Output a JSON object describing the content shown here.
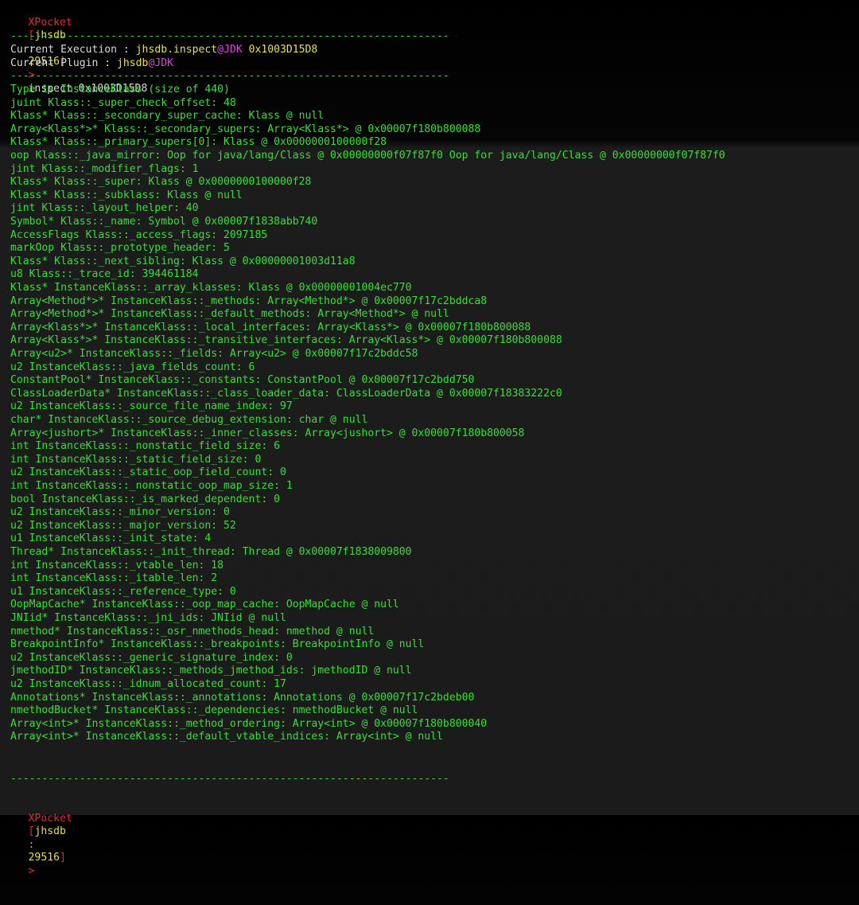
{
  "prompt": {
    "app": "XPocket",
    "open": "[",
    "plugin": "jhsdb",
    "sep": ":",
    "pid": "29516",
    "close": "]",
    "arrow": ">"
  },
  "command": "inspect 0x1003D15D8",
  "separator": "----------------------------------------------------------------------",
  "execution": {
    "label": "Current Execution : ",
    "plugin": "jhsdb",
    "dot": ".",
    "cmd": "inspect",
    "at": "@",
    "jdk": "JDK",
    "addr": " 0x1003D15D8"
  },
  "plugin_line": {
    "label": "Current Plugin : ",
    "plugin": "jhsdb",
    "at": "@",
    "jdk": "JDK"
  },
  "fields": [
    "Type is InstanceKlass (size of 440)",
    "juint Klass::_super_check_offset: 48",
    "Klass* Klass::_secondary_super_cache: Klass @ null",
    "Array<Klass*>* Klass::_secondary_supers: Array<Klass*> @ 0x00007f180b800088",
    "Klass* Klass::_primary_supers[0]: Klass @ 0x0000000100000f28",
    "oop Klass::_java_mirror: Oop for java/lang/Class @ 0x00000000f07f87f0 Oop for java/lang/Class @ 0x00000000f07f87f0",
    "jint Klass::_modifier_flags: 1",
    "Klass* Klass::_super: Klass @ 0x0000000100000f28",
    "Klass* Klass::_subklass: Klass @ null",
    "jint Klass::_layout_helper: 40",
    "Symbol* Klass::_name: Symbol @ 0x00007f1838abb740",
    "AccessFlags Klass::_access_flags: 2097185",
    "markOop Klass::_prototype_header: 5",
    "Klass* Klass::_next_sibling: Klass @ 0x00000001003d11a8",
    "u8 Klass::_trace_id: 394461184",
    "Klass* InstanceKlass::_array_klasses: Klass @ 0x00000001004ec770",
    "Array<Method*>* InstanceKlass::_methods: Array<Method*> @ 0x00007f17c2bddca8",
    "Array<Method*>* InstanceKlass::_default_methods: Array<Method*> @ null",
    "Array<Klass*>* InstanceKlass::_local_interfaces: Array<Klass*> @ 0x00007f180b800088",
    "Array<Klass*>* InstanceKlass::_transitive_interfaces: Array<Klass*> @ 0x00007f180b800088",
    "Array<u2>* InstanceKlass::_fields: Array<u2> @ 0x00007f17c2bddc58",
    "u2 InstanceKlass::_java_fields_count: 6",
    "ConstantPool* InstanceKlass::_constants: ConstantPool @ 0x00007f17c2bdd750",
    "ClassLoaderData* InstanceKlass::_class_loader_data: ClassLoaderData @ 0x00007f18383222c0",
    "u2 InstanceKlass::_source_file_name_index: 97",
    "char* InstanceKlass::_source_debug_extension: char @ null",
    "Array<jushort>* InstanceKlass::_inner_classes: Array<jushort> @ 0x00007f180b800058",
    "int InstanceKlass::_nonstatic_field_size: 6",
    "int InstanceKlass::_static_field_size: 0",
    "u2 InstanceKlass::_static_oop_field_count: 0",
    "int InstanceKlass::_nonstatic_oop_map_size: 1",
    "bool InstanceKlass::_is_marked_dependent: 0",
    "u2 InstanceKlass::_minor_version: 0",
    "u2 InstanceKlass::_major_version: 52",
    "u1 InstanceKlass::_init_state: 4",
    "Thread* InstanceKlass::_init_thread: Thread @ 0x00007f1838009800",
    "int InstanceKlass::_vtable_len: 18",
    "int InstanceKlass::_itable_len: 2",
    "u1 InstanceKlass::_reference_type: 0",
    "OopMapCache* InstanceKlass::_oop_map_cache: OopMapCache @ null",
    "JNIid* InstanceKlass::_jni_ids: JNIid @ null",
    "nmethod* InstanceKlass::_osr_nmethods_head: nmethod @ null",
    "BreakpointInfo* InstanceKlass::_breakpoints: BreakpointInfo @ null",
    "u2 InstanceKlass::_generic_signature_index: 0",
    "jmethodID* InstanceKlass::_methods_jmethod_ids: jmethodID @ null",
    "u2 InstanceKlass::_idnum_allocated_count: 17",
    "Annotations* InstanceKlass::_annotations: Annotations @ 0x00007f17c2bdeb00",
    "nmethodBucket* InstanceKlass::_dependencies: nmethodBucket @ null",
    "Array<int>* InstanceKlass::_method_ordering: Array<int> @ 0x00007f180b800040",
    "Array<int>* InstanceKlass::_default_vtable_indices: Array<int> @ null"
  ]
}
